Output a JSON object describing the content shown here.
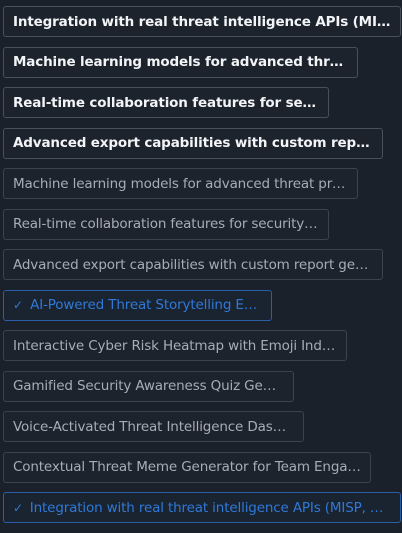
{
  "suggestions": {
    "items": [
      {
        "label": "Integration with real threat intelligence APIs (MISP, OpenCTI)",
        "state": "bright"
      },
      {
        "label": "Machine learning models for advanced threat prediction",
        "state": "bright"
      },
      {
        "label": "Real-time collaboration features for security teams",
        "state": "bright"
      },
      {
        "label": "Advanced export capabilities with custom report generation",
        "state": "bright"
      },
      {
        "label": "Machine learning models for advanced threat prediction",
        "state": "dim"
      },
      {
        "label": "Real-time collaboration features for security teams",
        "state": "dim"
      },
      {
        "label": "Advanced export capabilities with custom report generation",
        "state": "dim"
      },
      {
        "label": "AI-Powered Threat Storytelling Engine",
        "state": "selected",
        "icon": "check-icon"
      },
      {
        "label": "Interactive Cyber Risk Heatmap with Emoji Indicators",
        "state": "dim"
      },
      {
        "label": "Gamified Security Awareness Quiz Generator",
        "state": "dim"
      },
      {
        "label": "Voice-Activated Threat Intelligence Dashboard",
        "state": "dim"
      },
      {
        "label": "Contextual Threat Meme Generator for Team Engagement",
        "state": "dim"
      },
      {
        "label": "Integration with real threat intelligence APIs (MISP, OpenCTI)",
        "state": "selected",
        "icon": "check-icon"
      }
    ],
    "check_glyph": "✓"
  },
  "colors": {
    "background": "#1b212a",
    "accent": "#2f79d8"
  }
}
